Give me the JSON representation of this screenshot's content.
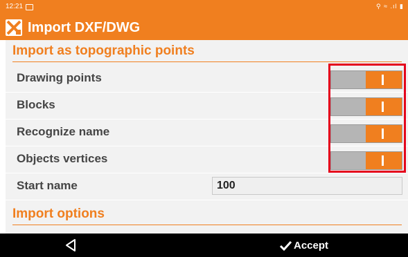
{
  "status_bar": {
    "time": "12:21",
    "right_icons": "⚲ ≈ .ıl ▮"
  },
  "app": {
    "title": "Import DXF/DWG",
    "icon": "x-logo-icon"
  },
  "sections": {
    "topographic": {
      "title": "Import as topographic points",
      "toggles": [
        {
          "label": "Drawing points",
          "state": "on"
        },
        {
          "label": "Blocks",
          "state": "on"
        },
        {
          "label": "Recognize name",
          "state": "on"
        },
        {
          "label": "Objects vertices",
          "state": "on"
        }
      ],
      "start_name": {
        "label": "Start name",
        "value": "100"
      }
    },
    "options": {
      "title": "Import options"
    }
  },
  "nav": {
    "accept_label": "Accept",
    "back_icon": "back-triangle-icon"
  },
  "colors": {
    "accent": "#f07f1f",
    "highlight": "#e4001b",
    "toggle_off": "#b5b5b5"
  }
}
